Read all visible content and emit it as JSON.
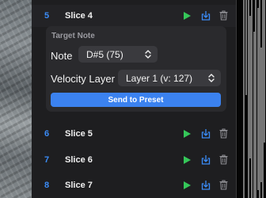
{
  "slices": [
    {
      "number": "5",
      "name": "Slice 4",
      "expanded": true
    },
    {
      "number": "6",
      "name": "Slice 5"
    },
    {
      "number": "7",
      "name": "Slice 6"
    },
    {
      "number": "8",
      "name": "Slice 7"
    }
  ],
  "target_note": {
    "section_label": "Target Note",
    "note_label": "Note",
    "note_value": "D#5 (75)",
    "velocity_label": "Velocity Layer",
    "velocity_value": "Layer 1 (v: 127)",
    "send_button": "Send to Preset"
  },
  "colors": {
    "accent": "#3b8cf7",
    "play": "#35c759",
    "button": "#3b82f0"
  },
  "icons": [
    "play-icon",
    "export-icon",
    "trash-icon",
    "chevron-up-down-icon"
  ]
}
